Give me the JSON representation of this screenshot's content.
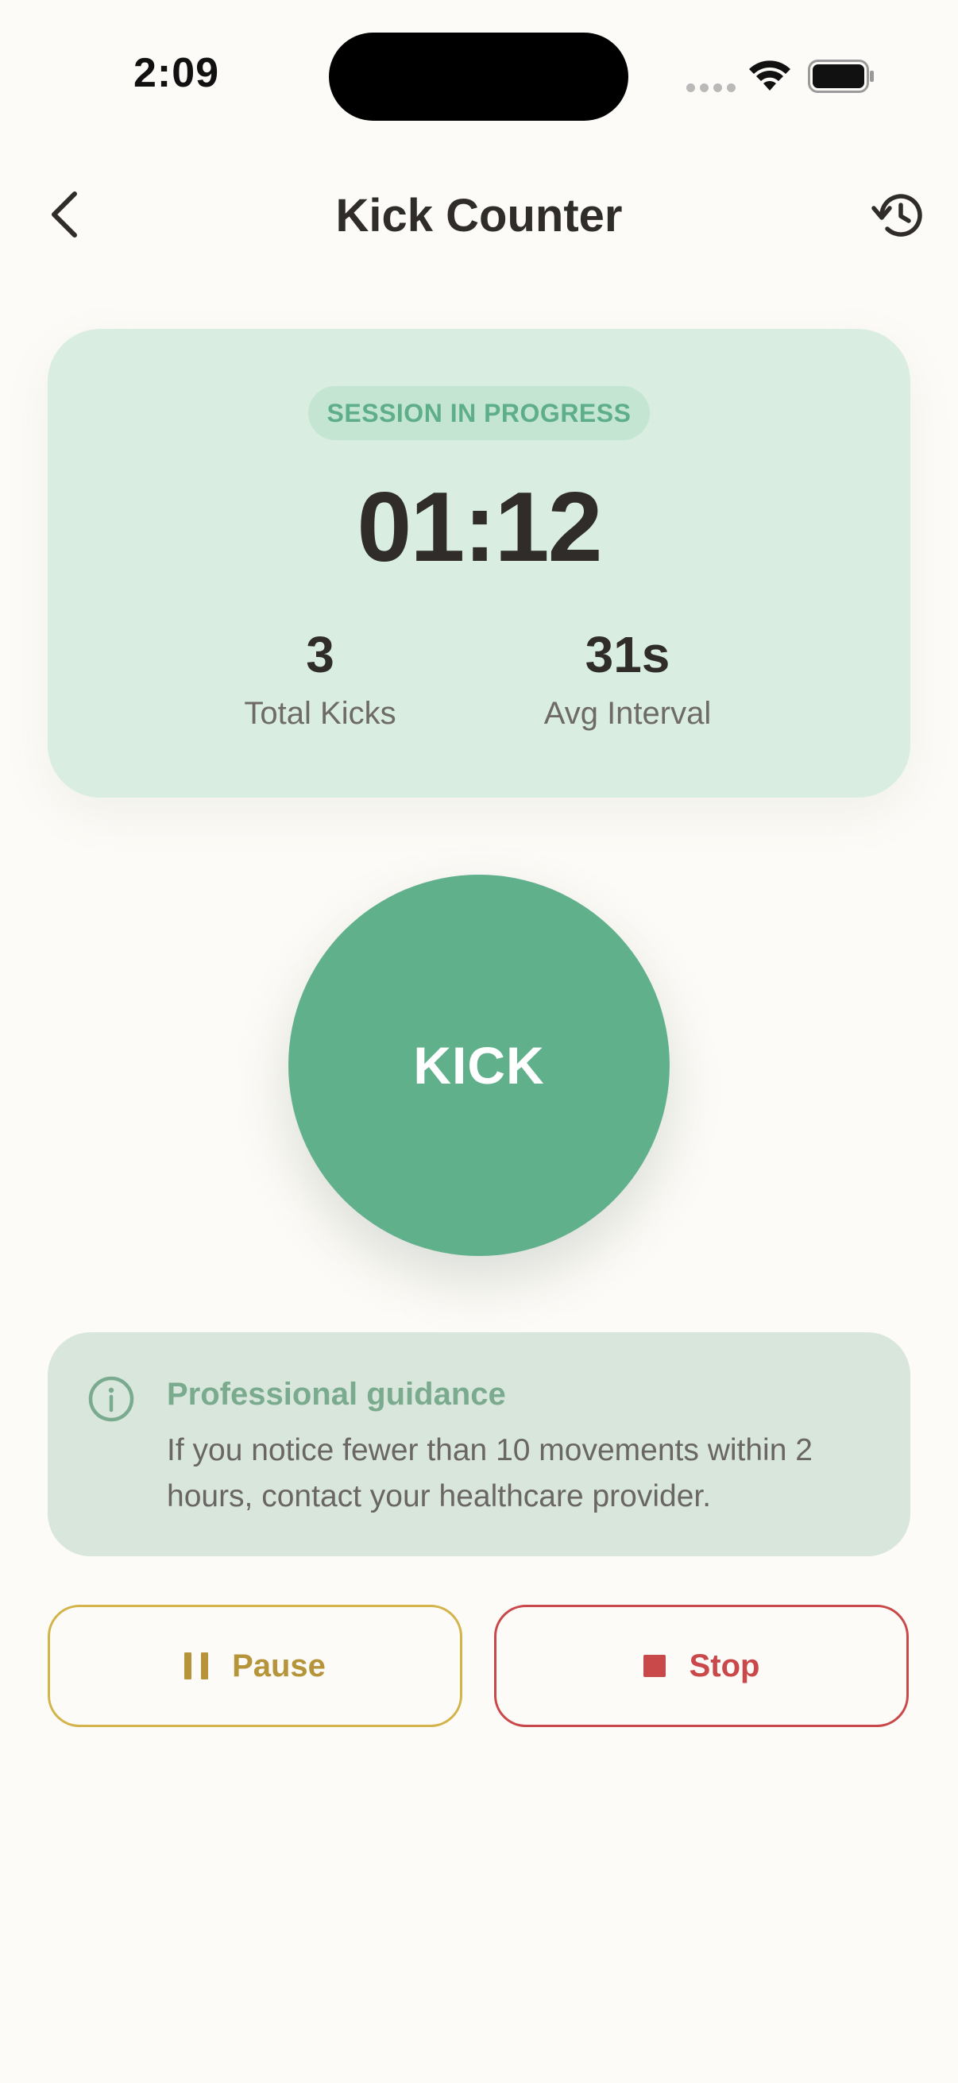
{
  "status_bar": {
    "time": "2:09"
  },
  "header": {
    "title": "Kick Counter",
    "back_icon": "chevron-left-icon",
    "history_icon": "history-clock-icon"
  },
  "session": {
    "badge": "SESSION IN PROGRESS",
    "timer": "01:12",
    "stats": [
      {
        "value": "3",
        "label": "Total Kicks"
      },
      {
        "value": "31s",
        "label": "Avg Interval"
      }
    ]
  },
  "kick_button": {
    "label": "KICK"
  },
  "guidance": {
    "icon": "info-icon",
    "title": "Professional guidance",
    "text": "If you notice fewer than 10 movements within 2 hours, contact your healthcare provider."
  },
  "controls": {
    "pause_label": "Pause",
    "stop_label": "Stop"
  },
  "colors": {
    "background": "#fdfbf7",
    "accent_green": "#61b08c",
    "session_card": "#d9eee1",
    "guidance_card": "#d8e6dc",
    "pause": "#b5943a",
    "stop": "#c9484a"
  }
}
